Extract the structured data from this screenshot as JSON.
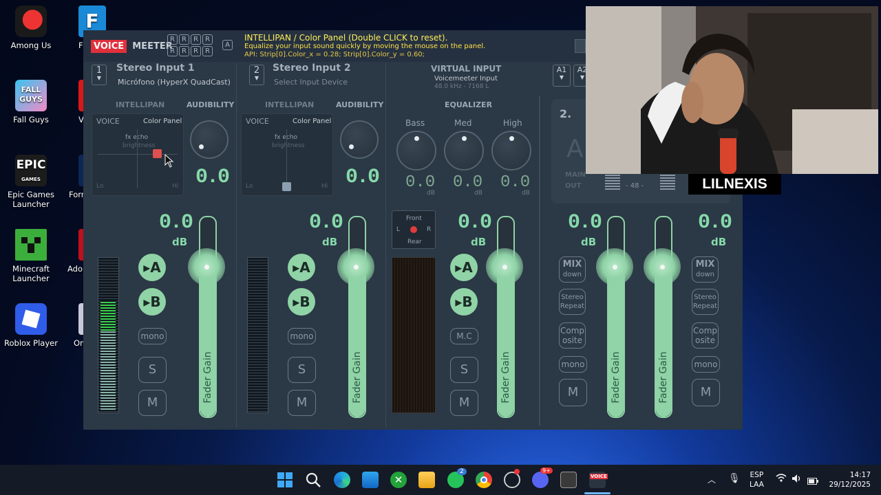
{
  "desktop": {
    "icons": [
      {
        "label": "Among Us"
      },
      {
        "label": "Fall Guys"
      },
      {
        "label": "Epic Games Launcher"
      },
      {
        "label": "Minecraft Launcher"
      },
      {
        "label": "Roblox Player"
      }
    ],
    "partial_icons": [
      "F",
      "V",
      "Forr",
      "Adol",
      "On"
    ],
    "f_icon_letter": "F",
    "epic_logo_text": "EPIC",
    "epic_logo_sub": "GAMES",
    "fallguys_logo_text": "FALL GUYS"
  },
  "voicemeeter": {
    "logo_voice": "VOICE",
    "logo_meeter": "MEETER",
    "reg_letters": [
      "R",
      "R",
      "R",
      "R",
      "R",
      "R",
      "R",
      "R"
    ],
    "reg_a": "A",
    "info_title": "INTELLIPAN / Color Panel (Double CLICK to reset).",
    "info_line1": "Equalize your input sound quickly by moving the mouse on the panel.",
    "info_line2": "API: Strip[0].Color_x = 0.28; Strip[0].Color_y = 0.60;",
    "strip1": {
      "num": "1",
      "name": "Stereo Input 1",
      "device": "Micrófono (HyperX QuadCast)",
      "intellipan": "INTELLIPAN",
      "audibility": "AUDIBILITY",
      "pan_voice": "VOICE",
      "pan_color": "Color Panel",
      "pan_echo": "fx echo",
      "pan_bright": "brightness",
      "pan_lo": "Lo",
      "pan_hi": "Hi",
      "aud_value": "0.0",
      "gain": "0.0",
      "gain_db": "dB",
      "btn_a": "▸A",
      "btn_b": "▸B",
      "mono": "mono",
      "solo": "S",
      "mute": "M",
      "fader": "Fader Gain"
    },
    "strip2": {
      "num": "2",
      "name": "Stereo Input 2",
      "device": "Select Input Device",
      "intellipan": "INTELLIPAN",
      "audibility": "AUDIBILITY",
      "pan_voice": "VOICE",
      "pan_color": "Color Panel",
      "pan_echo": "fx echo",
      "pan_bright": "brightness",
      "pan_lo": "Lo",
      "pan_hi": "Hi",
      "aud_value": "0.0",
      "gain": "0.0",
      "gain_db": "dB",
      "btn_a": "▸A",
      "btn_b": "▸B",
      "mono": "mono",
      "solo": "S",
      "mute": "M",
      "fader": "Fader Gain"
    },
    "virtual": {
      "title": "VIRTUAL INPUT",
      "device": "Voicemeeter Input",
      "rate": "48.0 kHz - 7168 L",
      "equalizer": "EQUALIZER",
      "bands": [
        {
          "label": "Bass",
          "value": "0.0",
          "unit": "dB"
        },
        {
          "label": "Med",
          "value": "0.0",
          "unit": "dB"
        },
        {
          "label": "High",
          "value": "0.0",
          "unit": "dB"
        }
      ],
      "pos_front": "Front",
      "pos_rear": "Rear",
      "pos_l": "L",
      "pos_r": "R",
      "gain": "0.0",
      "gain_db": "dB",
      "btn_a": "▸A",
      "btn_b": "▸B",
      "mc": "M.C",
      "solo": "S",
      "mute": "M",
      "fader": "Fader Gain"
    },
    "hw_out": {
      "a1": "A1",
      "a2": "A2",
      "main_digits": "2.",
      "main_letter": "A",
      "main_label": "MAIN",
      "out_label": "OUT",
      "level": "- 48 -"
    },
    "bus1": {
      "gain": "0.0",
      "db": "dB",
      "mix": "MIX",
      "mix_sub": "down",
      "stereo": "Stereo",
      "repeat": "Repeat",
      "comp": "Comp",
      "osite": "osite",
      "mono": "mono",
      "mute": "M",
      "fader": "Fader Gain"
    },
    "bus2": {
      "gain": "0.0",
      "db": "dB",
      "mix": "MIX",
      "mix_sub": "down",
      "stereo": "Stereo",
      "repeat": "Repeat",
      "comp": "Comp",
      "osite": "osite",
      "mono": "mono",
      "mute": "M",
      "fader": "Fader Gain"
    },
    "fader_level": 0.72,
    "meter1_level": 0.72
  },
  "webcam": {
    "streamer_name": "LILNEXIS"
  },
  "taskbar": {
    "lang": "ESP",
    "lang_sub": "LAA",
    "time": "14:17",
    "date": "29/12/2025",
    "whatsapp_badge": "2",
    "discord_badge": "9+",
    "vm_badge_text": "VOICE"
  },
  "colors": {
    "accent": "#8fd3a6",
    "panel": "#2b3845",
    "logo_red": "#e0303c"
  }
}
